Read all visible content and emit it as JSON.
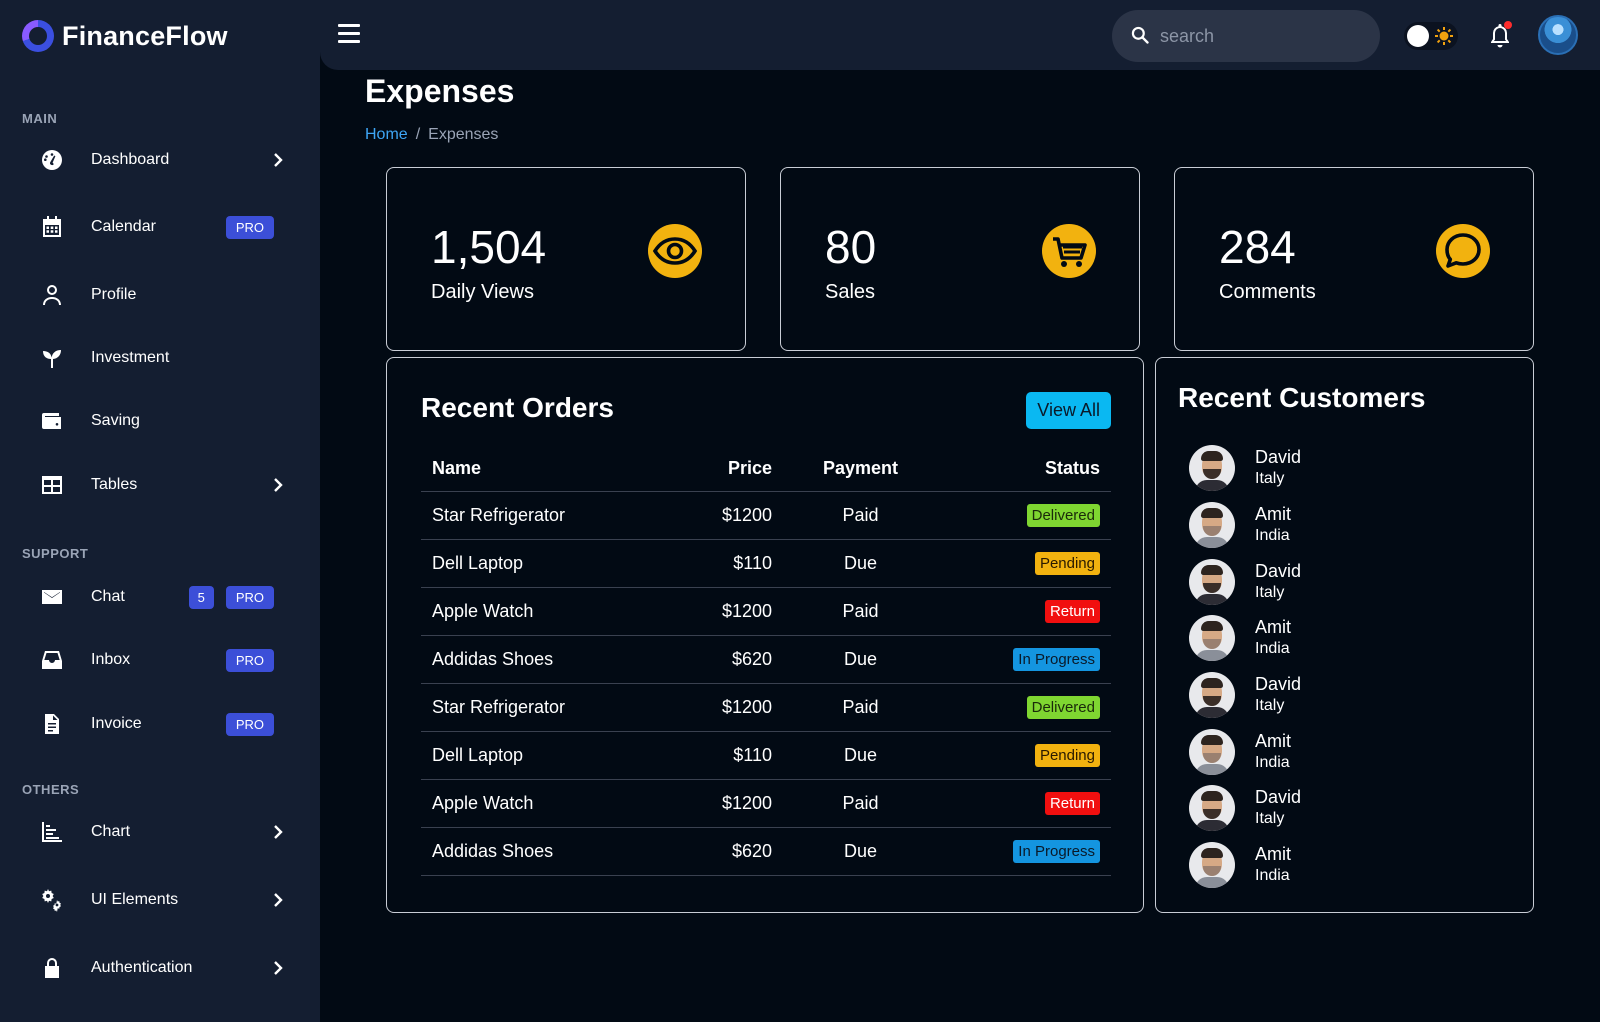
{
  "app": {
    "name": "FinanceFlow"
  },
  "sidebar": {
    "sections": [
      {
        "title": "MAIN"
      },
      {
        "title": "SUPPORT"
      },
      {
        "title": "OTHERS"
      }
    ],
    "items": [
      {
        "label": "Dashboard",
        "icon": "dashboard-icon"
      },
      {
        "label": "Calendar",
        "icon": "calendar-icon",
        "badge": "PRO"
      },
      {
        "label": "Profile",
        "icon": "user-icon"
      },
      {
        "label": "Investment",
        "icon": "sprout-icon"
      },
      {
        "label": "Saving",
        "icon": "wallet-icon"
      },
      {
        "label": "Tables",
        "icon": "table-icon"
      },
      {
        "label": "Chat",
        "icon": "envelope-icon",
        "count": "5",
        "badge": "PRO"
      },
      {
        "label": "Inbox",
        "icon": "inbox-icon",
        "badge": "PRO"
      },
      {
        "label": "Invoice",
        "icon": "invoice-icon",
        "badge": "PRO"
      },
      {
        "label": "Chart",
        "icon": "chart-icon"
      },
      {
        "label": "UI Elements",
        "icon": "gears-icon"
      },
      {
        "label": "Authentication",
        "icon": "lock-icon"
      }
    ]
  },
  "topbar": {
    "search_placeholder": "search"
  },
  "page": {
    "title": "Expenses",
    "breadcrumb": {
      "home": "Home",
      "separator": "/",
      "current": "Expenses"
    }
  },
  "stats": [
    {
      "value": "1,504",
      "label": "Daily Views",
      "icon": "eye-icon"
    },
    {
      "value": "80",
      "label": "Sales",
      "icon": "cart-icon"
    },
    {
      "value": "284",
      "label": "Comments",
      "icon": "comment-icon"
    }
  ],
  "orders": {
    "title": "Recent Orders",
    "view_all": "View All",
    "columns": {
      "name": "Name",
      "price": "Price",
      "payment": "Payment",
      "status": "Status"
    },
    "rows": [
      {
        "name": "Star Refrigerator",
        "price": "$1200",
        "payment": "Paid",
        "status": "Delivered"
      },
      {
        "name": "Dell Laptop",
        "price": "$110",
        "payment": "Due",
        "status": "Pending"
      },
      {
        "name": "Apple Watch",
        "price": "$1200",
        "payment": "Paid",
        "status": "Return"
      },
      {
        "name": "Addidas Shoes",
        "price": "$620",
        "payment": "Due",
        "status": "In Progress"
      },
      {
        "name": "Star Refrigerator",
        "price": "$1200",
        "payment": "Paid",
        "status": "Delivered"
      },
      {
        "name": "Dell Laptop",
        "price": "$110",
        "payment": "Due",
        "status": "Pending"
      },
      {
        "name": "Apple Watch",
        "price": "$1200",
        "payment": "Paid",
        "status": "Return"
      },
      {
        "name": "Addidas Shoes",
        "price": "$620",
        "payment": "Due",
        "status": "In Progress"
      }
    ]
  },
  "customers": {
    "title": "Recent Customers",
    "list": [
      {
        "name": "David",
        "country": "Italy"
      },
      {
        "name": "Amit",
        "country": "India"
      },
      {
        "name": "David",
        "country": "Italy"
      },
      {
        "name": "Amit",
        "country": "India"
      },
      {
        "name": "David",
        "country": "Italy"
      },
      {
        "name": "Amit",
        "country": "India"
      },
      {
        "name": "David",
        "country": "Italy"
      },
      {
        "name": "Amit",
        "country": "India"
      }
    ]
  },
  "colors": {
    "background": "#020a14",
    "sidebar": "#141e31",
    "accent": "#3c4fd8",
    "icon_yellow": "#f2b20f",
    "link": "#3ea6f5",
    "view_all": "#0ab8f2",
    "status_delivered": "#7fd631",
    "status_pending": "#f2b20f",
    "status_return": "#f10f0f",
    "status_in_progress": "#1495e0"
  }
}
